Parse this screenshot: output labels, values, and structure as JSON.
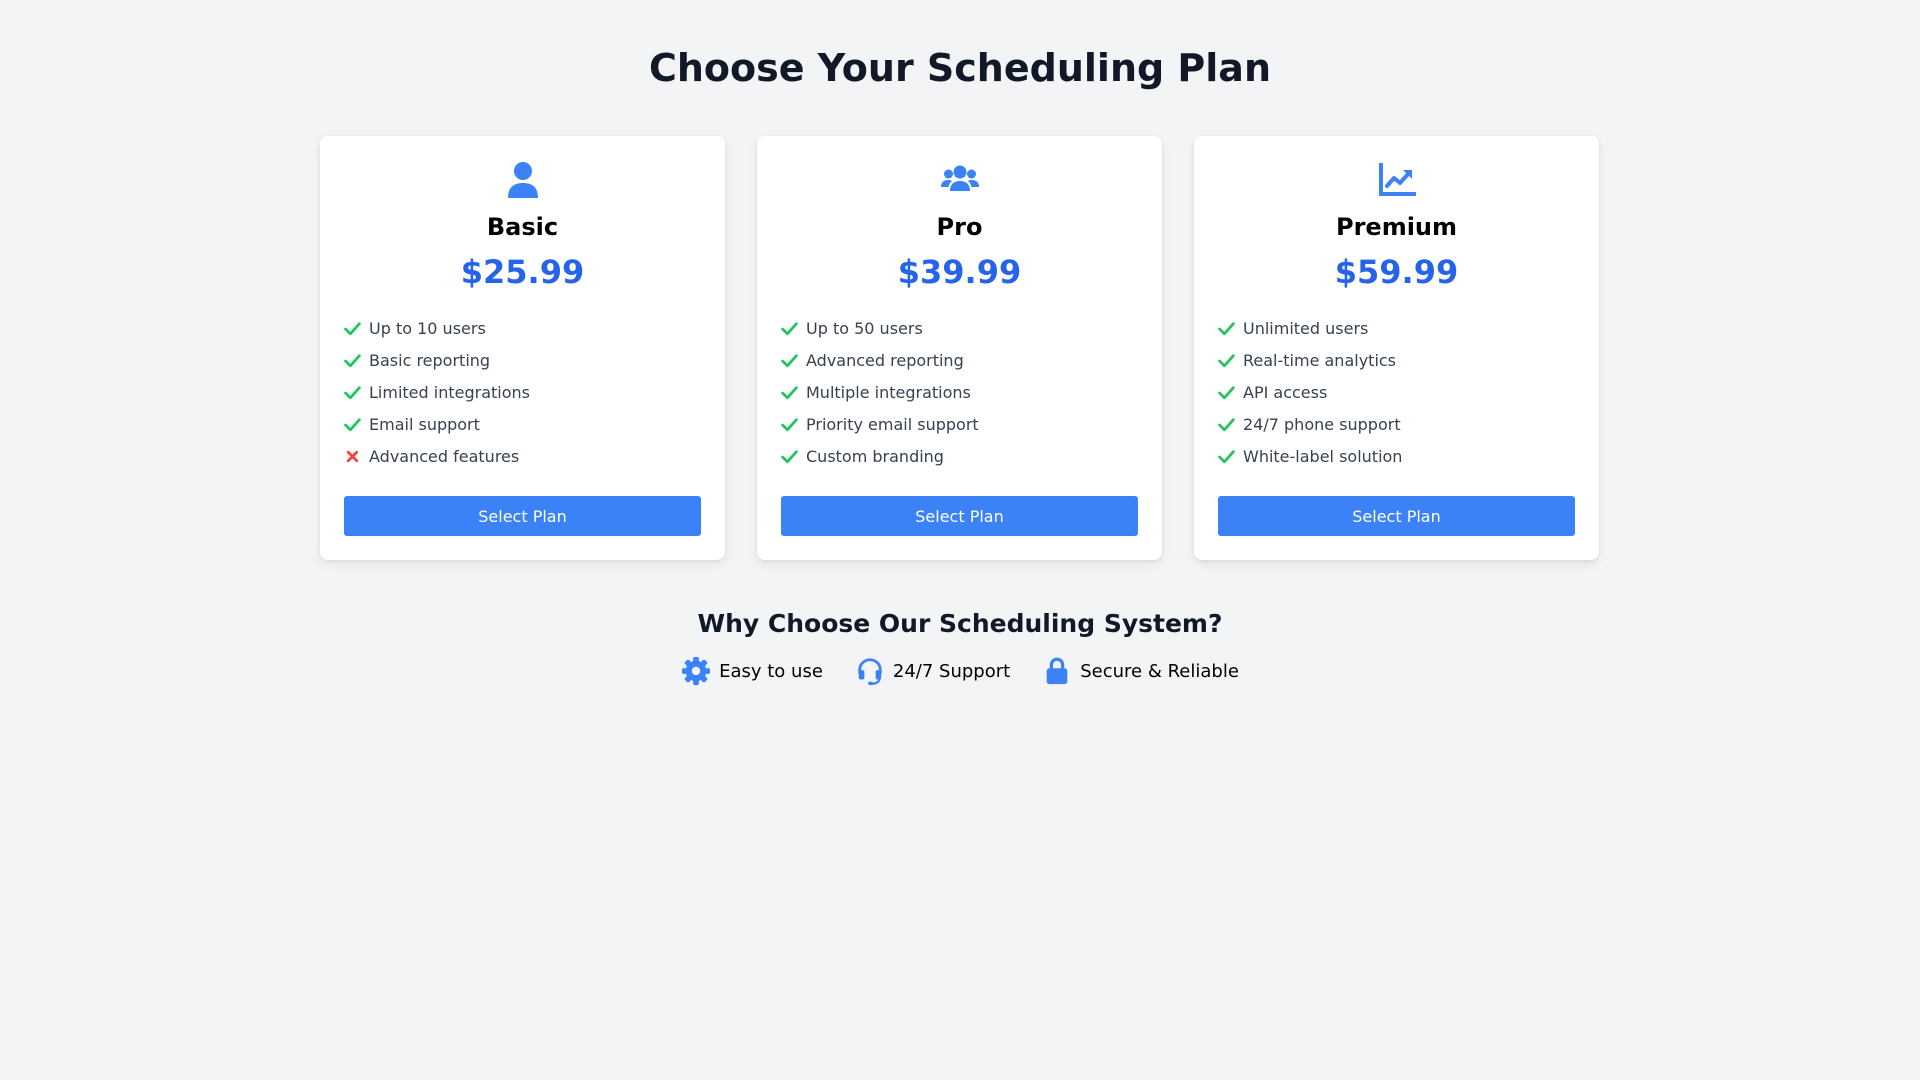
{
  "page": {
    "title": "Choose Your Scheduling Plan"
  },
  "colors": {
    "background": "#f3f4f6",
    "accent": "#3b82f6",
    "price": "#2563eb",
    "check": "#22c55e",
    "cross": "#ef4444"
  },
  "plans": [
    {
      "icon": "user-icon",
      "name": "Basic",
      "price": "$25.99",
      "features": [
        {
          "text": "Up to 10 users",
          "included": true
        },
        {
          "text": "Basic reporting",
          "included": true
        },
        {
          "text": "Limited integrations",
          "included": true
        },
        {
          "text": "Email support",
          "included": true
        },
        {
          "text": "Advanced features",
          "included": false
        }
      ],
      "button_label": "Select Plan"
    },
    {
      "icon": "users-icon",
      "name": "Pro",
      "price": "$39.99",
      "features": [
        {
          "text": "Up to 50 users",
          "included": true
        },
        {
          "text": "Advanced reporting",
          "included": true
        },
        {
          "text": "Multiple integrations",
          "included": true
        },
        {
          "text": "Priority email support",
          "included": true
        },
        {
          "text": "Custom branding",
          "included": true
        }
      ],
      "button_label": "Select Plan"
    },
    {
      "icon": "chart-line-icon",
      "name": "Premium",
      "price": "$59.99",
      "features": [
        {
          "text": "Unlimited users",
          "included": true
        },
        {
          "text": "Real-time analytics",
          "included": true
        },
        {
          "text": "API access",
          "included": true
        },
        {
          "text": "24/7 phone support",
          "included": true
        },
        {
          "text": "White-label solution",
          "included": true
        }
      ],
      "button_label": "Select Plan"
    }
  ],
  "why": {
    "title": "Why Choose Our Scheduling System?",
    "items": [
      {
        "icon": "gear-icon",
        "label": "Easy to use"
      },
      {
        "icon": "headset-icon",
        "label": "24/7 Support"
      },
      {
        "icon": "lock-icon",
        "label": "Secure & Reliable"
      }
    ]
  }
}
